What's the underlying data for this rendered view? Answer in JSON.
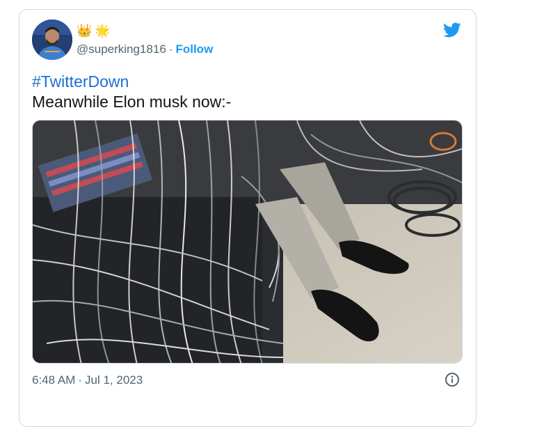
{
  "tweet": {
    "handle": "@superking1816",
    "separator": "·",
    "follow_label": "Follow",
    "badges": [
      "👑",
      "🌟"
    ],
    "hashtag": "#TwitterDown",
    "text": "Meanwhile Elon musk now:-",
    "time": "6:48 AM",
    "date": "Jul 1, 2023"
  },
  "colors": {
    "accent": "#1d9bf0",
    "hashtag": "#1d6fd3",
    "muted": "#536471",
    "border": "#cfd9de"
  },
  "icons": {
    "brand": "twitter-bird-icon",
    "info": "info-icon"
  }
}
